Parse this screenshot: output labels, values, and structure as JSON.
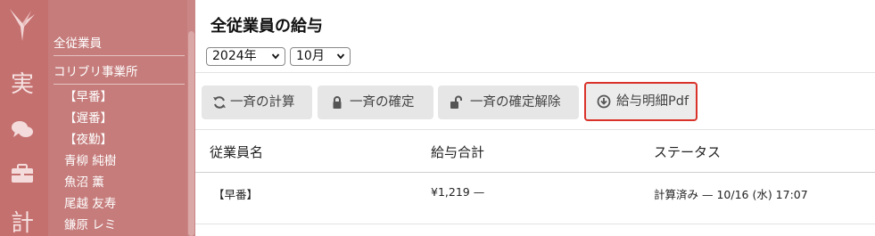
{
  "rail": {
    "items": [
      {
        "label": "実"
      },
      {
        "label": "計"
      }
    ]
  },
  "sidebar": {
    "all_employees": "全従業員",
    "company": "コリブリ事業所",
    "shifts": [
      "【早番】",
      "【遅番】",
      "【夜勤】"
    ],
    "employees": [
      "青柳 純樹",
      "魚沼 薫",
      "尾越 友寿",
      "鎌原 レミ"
    ]
  },
  "header": {
    "title": "全従業員の給与",
    "year_select": "2024年",
    "month_select": "10月"
  },
  "toolbar": {
    "calc_all": "一斉の計算",
    "confirm_all": "一斉の確定",
    "unconfirm_all": "一斉の確定解除",
    "payslip_pdf": "給与明細Pdf"
  },
  "table": {
    "columns": [
      "従業員名",
      "給与合計",
      "ステータス"
    ],
    "rows": [
      {
        "name": "【早番】",
        "total": "¥1,219 —",
        "status": "計算済み — 10/16 (水) 17:07"
      }
    ]
  },
  "colors": {
    "rail": "#c4706f",
    "sidebar": "#c57c7b",
    "focus_border": "#d9322a",
    "button_bg": "#e6e6e6"
  }
}
